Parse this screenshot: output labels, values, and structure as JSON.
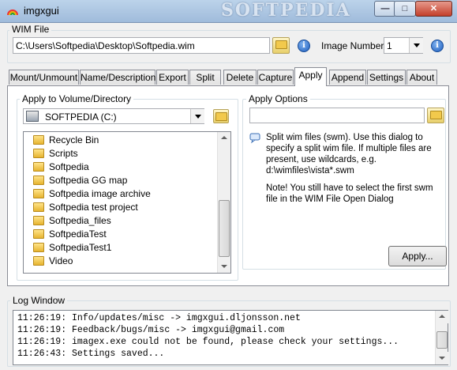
{
  "window": {
    "title": "imgxgui",
    "watermark": "SOFTPEDIA"
  },
  "wim_file": {
    "group_label": "WIM File",
    "path": "C:\\Users\\Softpedia\\Desktop\\Softpedia.wim",
    "image_number_label": "Image Number:",
    "image_number": "1"
  },
  "tabs": [
    {
      "label": "Mount/Unmount"
    },
    {
      "label": "Name/Description"
    },
    {
      "label": "Export"
    },
    {
      "label": "Split"
    },
    {
      "label": "Delete"
    },
    {
      "label": "Capture"
    },
    {
      "label": "Apply",
      "active": true
    },
    {
      "label": "Append"
    },
    {
      "label": "Settings"
    },
    {
      "label": "About"
    }
  ],
  "apply_to": {
    "group_label": "Apply to Volume/Directory",
    "drive": "SOFTPEDIA (C:)",
    "folders": [
      "Recycle Bin",
      "Scripts",
      "Softpedia",
      "Softpedia GG map",
      "Softpedia image archive",
      "Softpedia test project",
      "Softpedia_files",
      "SoftpediaTest",
      "SoftpediaTest1",
      "Video"
    ]
  },
  "apply_options": {
    "group_label": "Apply Options",
    "field_value": "",
    "help_text_1": "Split wim files (swm). Use this dialog to specify a split wim file. If multiple files are present, use wildcards, e.g. d:\\wimfiles\\vista*.swm",
    "help_text_2": "Note! You still have to select the first swm file in the WIM File Open Dialog",
    "apply_button": "Apply..."
  },
  "log": {
    "group_label": "Log Window",
    "lines": [
      "11:26:19: Info/updates/misc -> imgxgui.dljonsson.net",
      "11:26:19: Feedback/bugs/misc -> imgxgui@gmail.com",
      "11:26:19: imagex.exe could not be found, please check your settings...",
      "11:26:43: Settings saved..."
    ]
  },
  "icons": {
    "app": "rainbow-app-icon",
    "folder": "folder-icon",
    "info": "info-icon",
    "drive": "drive-icon",
    "balloon": "speech-balloon-icon"
  },
  "colors": {
    "titlebar": "#9fbbdb",
    "accent": "#1f5fbf",
    "close": "#c4402b"
  }
}
